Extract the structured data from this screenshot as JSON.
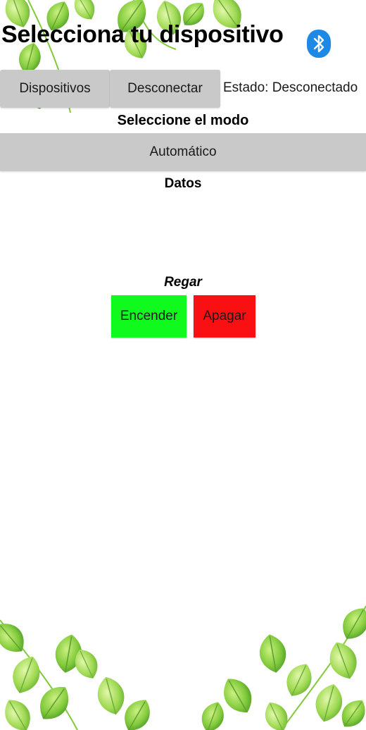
{
  "header": {
    "title": "Selecciona tu dispositivo",
    "bluetooth_icon": "bluetooth-icon"
  },
  "connection": {
    "devices_label": "Dispositivos",
    "disconnect_label": "Desconectar",
    "status": "Estado: Desconectado"
  },
  "mode": {
    "heading": "Seleccione el modo",
    "current": "Automático"
  },
  "data_section": {
    "heading": "Datos"
  },
  "irrigation": {
    "heading": "Regar",
    "on_label": "Encender",
    "off_label": "Apagar"
  },
  "colors": {
    "button_gray": "#c9c9c9",
    "on_green": "#10fa1e",
    "off_red": "#fa0f12",
    "bluetooth_blue": "#1e88e5"
  }
}
